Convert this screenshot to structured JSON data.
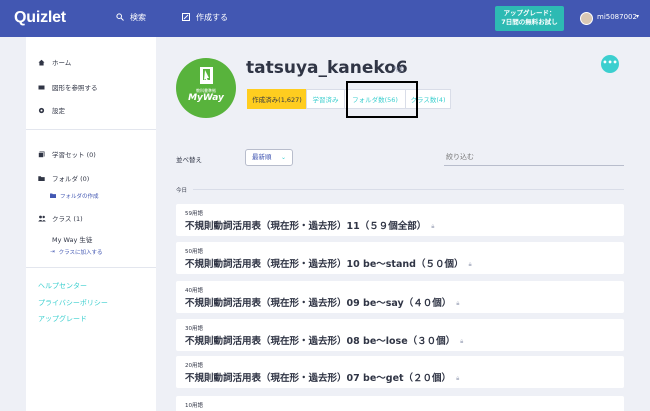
{
  "topbar": {
    "logo": "Quizlet",
    "search_label": "検索",
    "create_label": "作成する",
    "upgrade_line1": "アップグレード：",
    "upgrade_line2": "7日間の無料お試し",
    "username": "mi5087002",
    "caret": "▾"
  },
  "sidebar": {
    "home": "ホーム",
    "diagrams": "図形を参照する",
    "settings": "設定",
    "study_sets": "学習セット (0)",
    "folders": "フォルダ (0)",
    "create_folder": "フォルダの作成",
    "classes": "クラス (1)",
    "class_name": "My Way 生徒",
    "join_class": "クラスに加入する",
    "help_center": "ヘルプセンター",
    "privacy": "プライバシーポリシー",
    "upgrade": "アップグレード"
  },
  "profile": {
    "name": "tatsuya_kaneko6",
    "role": "先生",
    "avatar_line1": "教科書準拠",
    "avatar_line2": "MyWay",
    "more": "•••"
  },
  "tabs": [
    {
      "label": "作成済み(1,627)",
      "active": true
    },
    {
      "label": "学習済み",
      "active": false
    },
    {
      "label": "フォルダ数(56)",
      "active": false
    },
    {
      "label": "クラス数(4)",
      "active": false
    }
  ],
  "sort": {
    "label": "並べ替え",
    "value": "最新順",
    "filter_placeholder": "絞り込む"
  },
  "list": {
    "section": "今日",
    "sets": [
      {
        "count": "59用語",
        "title": "不規則動詞活用表（現在形・過去形）11（５９個全部）"
      },
      {
        "count": "50用語",
        "title": "不規則動詞活用表（現在形・過去形）10 be～stand（５０個）"
      },
      {
        "count": "40用語",
        "title": "不規則動詞活用表（現在形・過去形）09 be～say（４０個）"
      },
      {
        "count": "30用語",
        "title": "不規則動詞活用表（現在形・過去形）08 be～lose（３０個）"
      },
      {
        "count": "20用語",
        "title": "不規則動詞活用表（現在形・過去形）07 be～get（２０個）"
      },
      {
        "count": "10用語",
        "title": ""
      }
    ]
  },
  "colors": {
    "topbar": "#4257b2",
    "accent": "#3ccfcf",
    "active_tab": "#ffcd1f",
    "avatar_green": "#58b33c"
  }
}
